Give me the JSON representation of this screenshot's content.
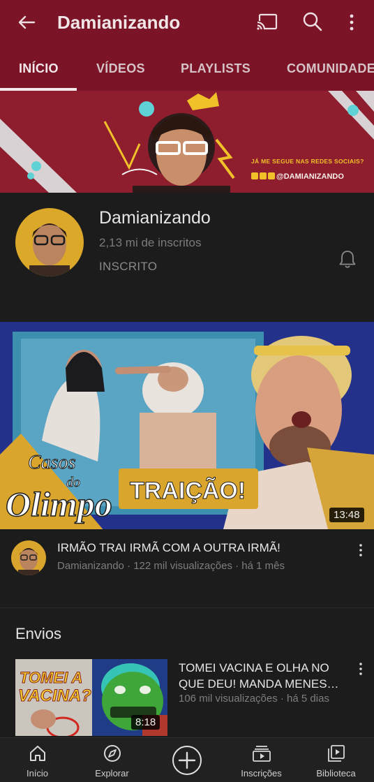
{
  "appbar": {
    "title": "Damianizando",
    "icons": [
      "back-arrow-icon",
      "cast-icon",
      "search-icon",
      "more-vert-icon"
    ]
  },
  "tabs": [
    "INÍCIO",
    "VÍDEOS",
    "PLAYLISTS",
    "COMUNIDADE"
  ],
  "banner": {
    "prompt": "JÁ ME SEGUE NAS REDES SOCIAIS?",
    "handle": "@DAMIANIZANDO"
  },
  "channel": {
    "name": "Damianizando",
    "subscribers": "2,13 mi de inscritos",
    "subscribe_state": "INSCRITO"
  },
  "featured": {
    "thumbnail_text_1": "Casos do",
    "thumbnail_text_2": "Olimpo",
    "thumbnail_text_3": "TRAIÇÃO!",
    "duration": "13:48",
    "title": "IRMÃO TRAI IRMÃ COM A OUTRA IRMÃ!",
    "meta": "Damianizando · 122 mil visualizações · há 1 mês"
  },
  "uploads": {
    "section_title": "Envios",
    "items": [
      {
        "thumbnail_text": "TOMEI A VACINA?",
        "duration": "8:18",
        "title_line1": "TOMEI VACINA E OLHA NO",
        "title_line2": "QUE DEU! MANDA MENES…",
        "meta": "106 mil visualizações · há 5 dias"
      }
    ]
  },
  "bottom_nav": [
    {
      "label": "Início",
      "icon": "home-icon"
    },
    {
      "label": "Explorar",
      "icon": "compass-icon"
    },
    {
      "label": "",
      "icon": "create-plus-icon"
    },
    {
      "label": "Inscrições",
      "icon": "subscriptions-icon"
    },
    {
      "label": "Biblioteca",
      "icon": "library-icon"
    }
  ],
  "colors": {
    "appbar": "#7a1426",
    "background": "#1c1c1c",
    "muted_text": "#7e7e7e"
  }
}
